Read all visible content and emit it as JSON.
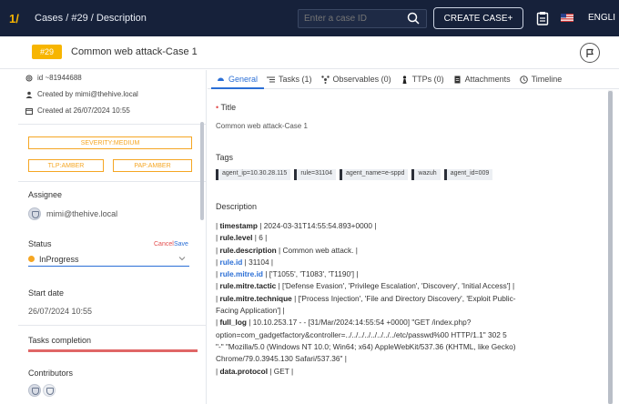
{
  "topbar": {
    "logo": "1/",
    "breadcrumb": "Cases / #29 / Description",
    "case_id_placeholder": "Enter a case ID",
    "create_case": "CREATE CASE+",
    "language": "ENGLI"
  },
  "header": {
    "case_number": "#29",
    "case_title": "Common web attack-Case 1"
  },
  "left": {
    "id_line": "id ~81944688",
    "created_by": "Created by  mimi@thehive.local",
    "created_at": "Created at  26/07/2024 10:55",
    "severity": "SEVERITY:MEDIUM",
    "tlp": "TLP:AMBER",
    "pap": "PAP:AMBER",
    "assignee_label": "Assignee",
    "assignee": "mimi@thehive.local",
    "status_label": "Status",
    "cancel": "Cancel",
    "save": "Save",
    "status_value": "InProgress",
    "start_date_label": "Start date",
    "start_date": "26/07/2024 10:55",
    "tasks_completion_label": "Tasks completion",
    "tasks_completion_fraction": 1.0,
    "contributors_label": "Contributors"
  },
  "tabs": [
    {
      "label": "General",
      "icon": "circle-icon"
    },
    {
      "label": "Tasks (1)",
      "icon": "list-icon"
    },
    {
      "label": "Observables (0)",
      "icon": "observables-icon"
    },
    {
      "label": "TTPs (0)",
      "icon": "chess-pawn-icon"
    },
    {
      "label": "Attachments",
      "icon": "file-icon"
    },
    {
      "label": "Timeline",
      "icon": "clock-icon"
    }
  ],
  "general": {
    "title_label": "Title",
    "title_value": "Common web attack-Case 1",
    "tags_label": "Tags",
    "tags": [
      "agent_ip=10.30.28.115",
      "rule=31104",
      "agent_name=e-sppd",
      "wazuh",
      "agent_id=009"
    ],
    "description_label": "Description",
    "description": {
      "l1_key": "timestamp",
      "l1_val": " | 2024-03-31T14:55:54.893+0000 |",
      "l2_key": "rule.level",
      "l2_val": " | 6 |",
      "l3_key": "rule.description",
      "l3_val": " | Common web attack. |",
      "l4_key": "rule.id",
      "l4_val": " | 31104 |",
      "l5_key": "rule.mitre.id",
      "l5_val": " | ['T1055', 'T1083', 'T1190'] |",
      "l6_key": "rule.mitre.tactic",
      "l6_val": " | ['Defense Evasion', 'Privilege Escalation', 'Discovery', 'Initial Access'] |",
      "l7_key": "rule.mitre.technique",
      "l7_val": " | ['Process Injection', 'File and Directory Discovery', 'Exploit Public-",
      "l7_cont": "Facing Application'] |",
      "l8_key": "full_log",
      "l8_val": " | 10.10.253.17 - - [31/Mar/2024:14:55:54 +0000] \"GET /index.php?",
      "l8_cont1": "option=com_gadgetfactory&controller=../../../../../../../../etc/passwd%00 HTTP/1.1\" 302 5",
      "l8_cont2": "\"-\" \"Mozilla/5.0 (Windows NT 10.0; Win64; x64) AppleWebKit/537.36 (KHTML, like Gecko)",
      "l8_cont3": "Chrome/79.0.3945.130 Safari/537.36\" |",
      "l9_key": "data.protocol",
      "l9_val": " | GET |"
    }
  }
}
